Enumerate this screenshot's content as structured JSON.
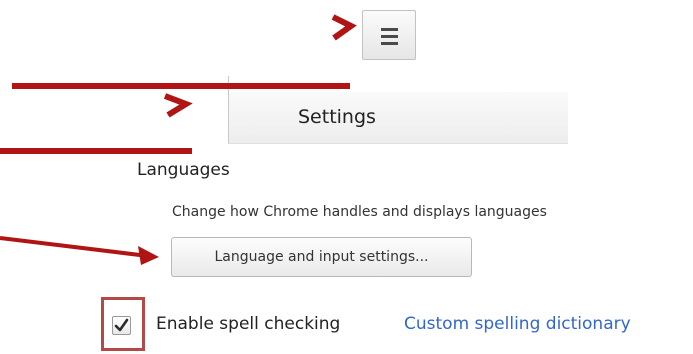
{
  "toolbar": {
    "menu_button_icon": "hamburger-menu-icon"
  },
  "settings_header": {
    "title": "Settings"
  },
  "languages": {
    "section_title": "Languages",
    "description": "Change how Chrome handles and displays languages",
    "settings_button_label": "Language and input settings..."
  },
  "spell_check": {
    "checkbox_label": "Enable spell checking",
    "checked": true,
    "dictionary_link": "Custom spelling dictionary"
  },
  "annotation": {
    "color": "#b01414",
    "highlight_color": "#b34a4a"
  }
}
